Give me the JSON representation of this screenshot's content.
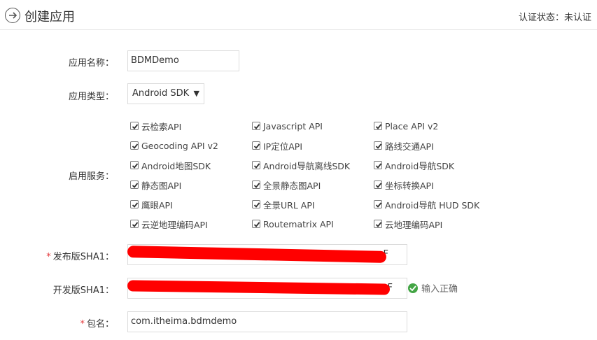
{
  "header": {
    "title": "创建应用",
    "cert_status": "认证状态：未认证"
  },
  "form": {
    "app_name": {
      "label": "应用名称：",
      "value": "BDMDemo"
    },
    "app_type": {
      "label": "应用类型：",
      "value": "Android SDK"
    },
    "services": {
      "label": "启用服务：",
      "items": [
        "云检索API",
        "Javascript API",
        "Place API v2",
        "Geocoding API v2",
        "IP定位API",
        "路线交通API",
        "Android地图SDK",
        "Android导航离线SDK",
        "Android导航SDK",
        "静态图API",
        "全景静态图API",
        "坐标转换API",
        "鹰眼API",
        "全景URL API",
        "Android导航 HUD SDK",
        "云逆地理编码API",
        "Routematrix API",
        "云地理编码API"
      ]
    },
    "release_sha1": {
      "required_mark": "*",
      "label": "发布版SHA1：",
      "visible_end": "F"
    },
    "dev_sha1": {
      "label": "开发版SHA1：",
      "visible_end": "F",
      "hint": "输入正确"
    },
    "package": {
      "required_mark": "*",
      "label": "包名：",
      "value": "com.itheima.bdmdemo"
    }
  },
  "colors": {
    "redaction": "#ff0000",
    "required": "#e4393c",
    "ok": "#43a545"
  }
}
